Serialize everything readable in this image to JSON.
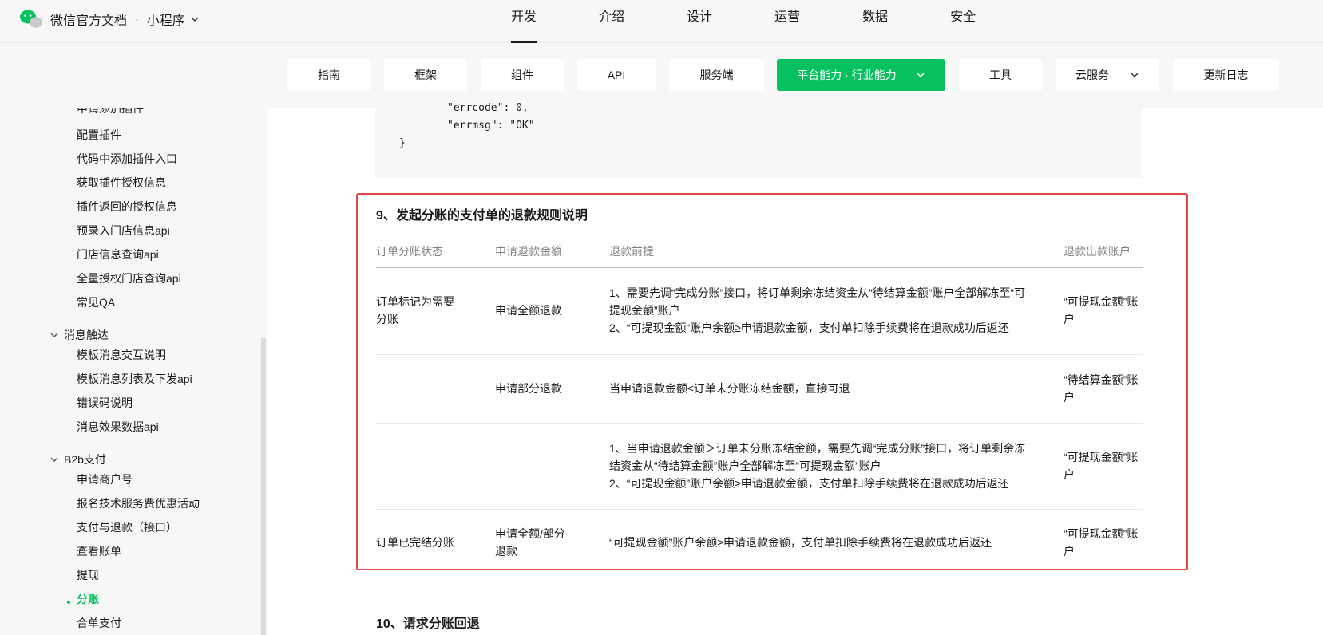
{
  "header": {
    "brand": "微信官方文档",
    "separator": "·",
    "product": "小程序",
    "nav": [
      "开发",
      "介绍",
      "设计",
      "运营",
      "数据",
      "安全"
    ]
  },
  "subnav": {
    "items": [
      "指南",
      "框架",
      "组件",
      "API",
      "服务端",
      "平台能力 · 行业能力",
      "工具",
      "云服务",
      "更新日志"
    ],
    "active": "平台能力 · 行业能力"
  },
  "sidebar": {
    "items_top": [
      "申请添加插件",
      "配置插件",
      "代码中添加插件入口",
      "获取插件授权信息",
      "插件返回的授权信息",
      "预录入门店信息api",
      "门店信息查询api",
      "全量授权门店查询api",
      "常见QA"
    ],
    "group_message": "消息触达",
    "items_message": [
      "模板消息交互说明",
      "模板消息列表及下发api",
      "错误码说明",
      "消息效果数据api"
    ],
    "group_b2b": "B2b支付",
    "items_b2b": [
      "申请商户号",
      "报名技术服务费优惠活动",
      "支付与退款（接口）",
      "查看账单",
      "提现"
    ],
    "current": "分账",
    "items_after": [
      "合单支付"
    ]
  },
  "code": {
    "line1": "\"errcode\": 0,",
    "line2": "\"errmsg\": \"OK\"",
    "line3": "}"
  },
  "section9": {
    "title": "9、发起分账的支付单的退款规则说明",
    "headers": [
      "订单分账状态",
      "申请退款金额",
      "退款前提",
      "退款出款账户"
    ],
    "rows": [
      {
        "status": [
          "订单标记为需要",
          "分账"
        ],
        "amount": [
          "申请全额退款"
        ],
        "condition": [
          "1、需要先调“完成分账”接口，将订单剩余冻结资金从“待结算金额”账户全部解冻至“可",
          "提现金额”账户",
          "2、“可提现金额”账户余额≥申请退款金额，支付单扣除手续费将在退款成功后返还"
        ],
        "account": [
          "“可提现金额”账",
          "户"
        ]
      },
      {
        "status": [],
        "amount": [
          "申请部分退款"
        ],
        "condition": [
          "当申请退款金额≤订单未分账冻结金额，直接可退"
        ],
        "account": [
          "“待结算金额”账",
          "户"
        ]
      },
      {
        "status": [],
        "amount": [],
        "condition": [
          "1、当申请退款金额＞订单未分账冻结金额，需要先调“完成分账”接口，将订单剩余冻",
          "结资金从“待结算金额”账户全部解冻至“可提现金额”账户",
          "2、“可提现金额”账户余额≥申请退款金额，支付单扣除手续费将在退款成功后返还"
        ],
        "account": [
          "“可提现金额”账",
          "户"
        ]
      },
      {
        "status": [
          "订单已完结分账"
        ],
        "amount": [
          "申请全额/部分",
          "退款"
        ],
        "condition": [
          "“可提现金额”账户余额≥申请退款金额，支付单扣除手续费将在退款成功后返还"
        ],
        "account": [
          "“可提现金额”账",
          "户"
        ]
      }
    ]
  },
  "section10": {
    "title": "10、请求分账回退"
  },
  "colors": {
    "accent": "#07c160",
    "highlight_border": "#e64545"
  }
}
